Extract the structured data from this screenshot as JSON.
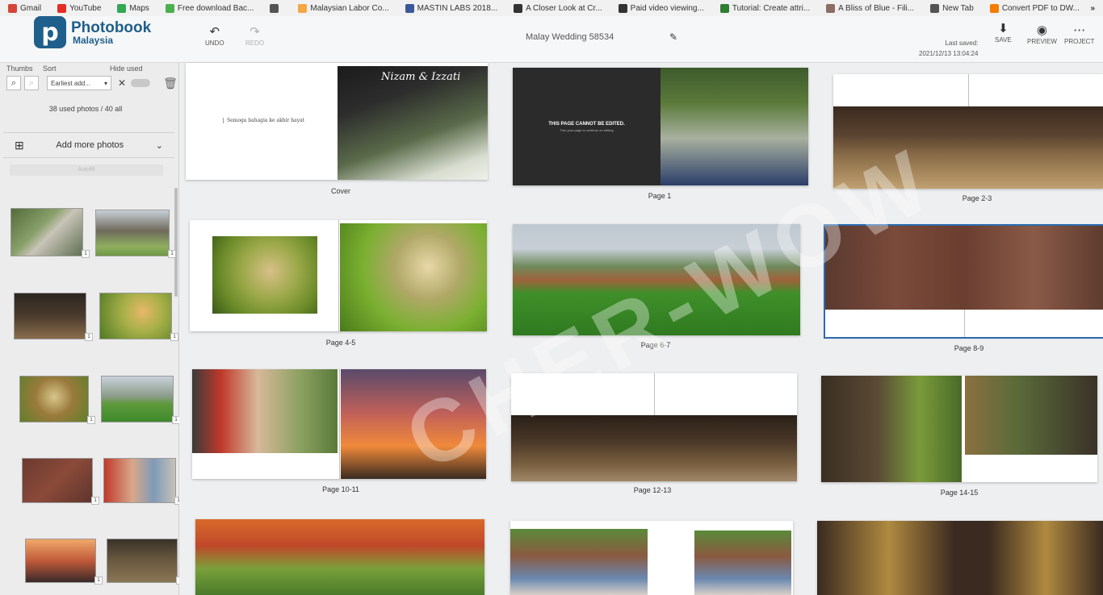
{
  "bookmarks": [
    {
      "label": "Gmail",
      "color": "#d44638"
    },
    {
      "label": "YouTube",
      "color": "#e52d27"
    },
    {
      "label": "Maps",
      "color": "#34a853"
    },
    {
      "label": "Free download Bac...",
      "color": "#4caf50"
    },
    {
      "label": "",
      "color": "#555555"
    },
    {
      "label": "Malaysian Labor Co...",
      "color": "#f4a742"
    },
    {
      "label": "MASTIN LABS 2018...",
      "color": "#3b5998"
    },
    {
      "label": "A Closer Look at Cr...",
      "color": "#333333"
    },
    {
      "label": "Paid video viewing...",
      "color": "#333333"
    },
    {
      "label": "Tutorial: Create attri...",
      "color": "#2e7d32"
    },
    {
      "label": "A Bliss of Blue - Fili...",
      "color": "#8d6e63"
    },
    {
      "label": "New Tab",
      "color": "#555555"
    },
    {
      "label": "Convert PDF to DW...",
      "color": "#f57c00"
    }
  ],
  "bookmarks_more": "»",
  "logo": {
    "mark": "p",
    "name": "Photobook",
    "sub": "Malaysia"
  },
  "header": {
    "undo": "UNDO",
    "redo": "REDO",
    "project_name": "Malay Wedding 58534",
    "last_saved_label": "Last saved:",
    "last_saved_time": "2021/12/13 13:04:24",
    "save": "SAVE",
    "preview": "PREVIEW",
    "project": "PROJECT"
  },
  "sidebar": {
    "labels": {
      "thumbs": "Thumbs",
      "sort": "Sort",
      "hide_used": "Hide used"
    },
    "sort_value": "Earliest add...",
    "used_count": "38 used photos / 40 all",
    "add_more": "Add more photos",
    "faded_button": "Autofill",
    "thumb_badge": "1"
  },
  "pages": {
    "cover": "Cover",
    "cover_text": "Semoga bahagia ke akhir hayat",
    "cover_script": "Nizam & Izzati",
    "p1": "Page 1",
    "locked_title": "THIS PAGE CANNOT BE EDITED.",
    "locked_sub": "Turn your page to continue on editing",
    "p2_3": "Page 2-3",
    "p4_5": "Page 4-5",
    "p6_7": "Page 6-7",
    "p8_9": "Page 8-9",
    "p10_11": "Page 10-11",
    "p12_13": "Page 12-13",
    "p14_15": "Page 14-15"
  },
  "watermark": "CHER-WOW",
  "colors": {
    "brand": "#1f5f8b",
    "selection": "#2a6ab0"
  }
}
